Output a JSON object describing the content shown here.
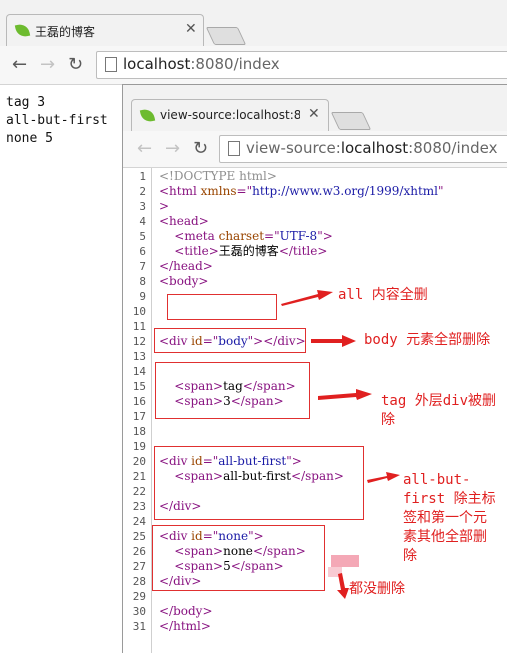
{
  "outer": {
    "tab_title": "王磊的博客",
    "url_host": "localhost",
    "url_rest": ":8080/index",
    "page_lines": [
      "tag 3",
      "all-but-first",
      "none 5"
    ]
  },
  "inner": {
    "tab_title": "view-source:localhost:8",
    "url_scheme": "view-source:",
    "url_host": "localhost",
    "url_rest": ":8080/index",
    "line_numbers": [
      "1",
      "2",
      "3",
      "4",
      "5",
      "6",
      "7",
      "8",
      "9",
      "10",
      "11",
      "12",
      "13",
      "14",
      "15",
      "16",
      "17",
      "18",
      "19",
      "20",
      "21",
      "22",
      "23",
      "24",
      "25",
      "26",
      "27",
      "28",
      "29",
      "30",
      "31"
    ],
    "source_lines": [
      [
        [
          "cm",
          "<!DOCTYPE html>"
        ]
      ],
      [
        [
          "tg",
          "<html "
        ],
        [
          "at",
          "xmlns"
        ],
        [
          "tg",
          "=\""
        ],
        [
          "av",
          "http://www.w3.org/1999/xhtml"
        ],
        [
          "tg",
          "\""
        ]
      ],
      [
        [
          "tg",
          ">"
        ]
      ],
      [
        [
          "tg",
          "<head>"
        ]
      ],
      [
        [
          "tx",
          "    "
        ],
        [
          "tg",
          "<meta "
        ],
        [
          "at",
          "charset"
        ],
        [
          "tg",
          "=\""
        ],
        [
          "av",
          "UTF-8"
        ],
        [
          "tg",
          "\">"
        ]
      ],
      [
        [
          "tx",
          "    "
        ],
        [
          "tg",
          "<title>"
        ],
        [
          "tx",
          "王磊的博客"
        ],
        [
          "tg",
          "</title>"
        ]
      ],
      [
        [
          "tg",
          "</head>"
        ]
      ],
      [
        [
          "tg",
          "<body>"
        ]
      ],
      [],
      [],
      [],
      [
        [
          "tg",
          "<div "
        ],
        [
          "at",
          "id"
        ],
        [
          "tg",
          "=\""
        ],
        [
          "av",
          "body"
        ],
        [
          "tg",
          "\"></div>"
        ]
      ],
      [],
      [],
      [
        [
          "tx",
          "    "
        ],
        [
          "tg",
          "<span>"
        ],
        [
          "tx",
          "tag"
        ],
        [
          "tg",
          "</span>"
        ]
      ],
      [
        [
          "tx",
          "    "
        ],
        [
          "tg",
          "<span>"
        ],
        [
          "tx",
          "3"
        ],
        [
          "tg",
          "</span>"
        ]
      ],
      [],
      [],
      [],
      [
        [
          "tg",
          "<div "
        ],
        [
          "at",
          "id"
        ],
        [
          "tg",
          "=\""
        ],
        [
          "av",
          "all-but-first"
        ],
        [
          "tg",
          "\">"
        ]
      ],
      [
        [
          "tx",
          "    "
        ],
        [
          "tg",
          "<span>"
        ],
        [
          "tx",
          "all-but-first"
        ],
        [
          "tg",
          "</span>"
        ]
      ],
      [],
      [
        [
          "tg",
          "</div>"
        ]
      ],
      [],
      [
        [
          "tg",
          "<div "
        ],
        [
          "at",
          "id"
        ],
        [
          "tg",
          "=\""
        ],
        [
          "av",
          "none"
        ],
        [
          "tg",
          "\">"
        ]
      ],
      [
        [
          "tx",
          "    "
        ],
        [
          "tg",
          "<span>"
        ],
        [
          "tx",
          "none"
        ],
        [
          "tg",
          "</span>"
        ]
      ],
      [
        [
          "tx",
          "    "
        ],
        [
          "tg",
          "<span>"
        ],
        [
          "tx",
          "5"
        ],
        [
          "tg",
          "</span>"
        ]
      ],
      [
        [
          "tg",
          "</div>"
        ]
      ],
      [],
      [
        [
          "tg",
          "</body>"
        ]
      ],
      [
        [
          "tg",
          "</html>"
        ]
      ]
    ]
  },
  "annotations": {
    "all": "all 内容全删",
    "body": "body 元素全部删除",
    "tag_line1": "tag 外层div被删",
    "tag_line2": "除",
    "abf_line1": "all-but-",
    "abf_line2": "first 除主标",
    "abf_line3": "签和第一个元",
    "abf_line4": "素其他全部删",
    "abf_line5": "除",
    "none": "都没删除"
  },
  "colors": {
    "annotation": "#e02020",
    "tag": "#881280",
    "attr_name": "#994500",
    "attr_value": "#1a1aa6",
    "comment": "#8e8e8e",
    "favicon": "#6dbb2f"
  },
  "icons": [
    "leaf-favicon-icon",
    "close-icon",
    "back-arrow-icon",
    "forward-arrow-icon",
    "reload-icon",
    "page-icon"
  ]
}
